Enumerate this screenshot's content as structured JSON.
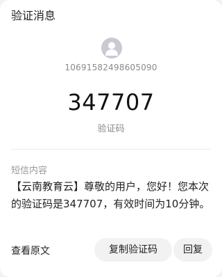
{
  "header": {
    "title": "验证消息"
  },
  "sender": {
    "avatar_icon": "person-icon",
    "number": "10691582498605090"
  },
  "verification": {
    "code": "347707",
    "code_label": "验证码"
  },
  "message": {
    "section_label": "短信内容",
    "body": "【云南教育云】尊敬的用户，您好！您本次的验证码是347707，有效时间为10分钟。"
  },
  "actions": {
    "view_original": "查看原文",
    "copy_code": "复制验证码",
    "reply": "回复"
  },
  "colors": {
    "avatar_bg": "#c9cbd3",
    "button_bg": "#f2f2f2",
    "secondary_text": "#8a8a8a"
  }
}
